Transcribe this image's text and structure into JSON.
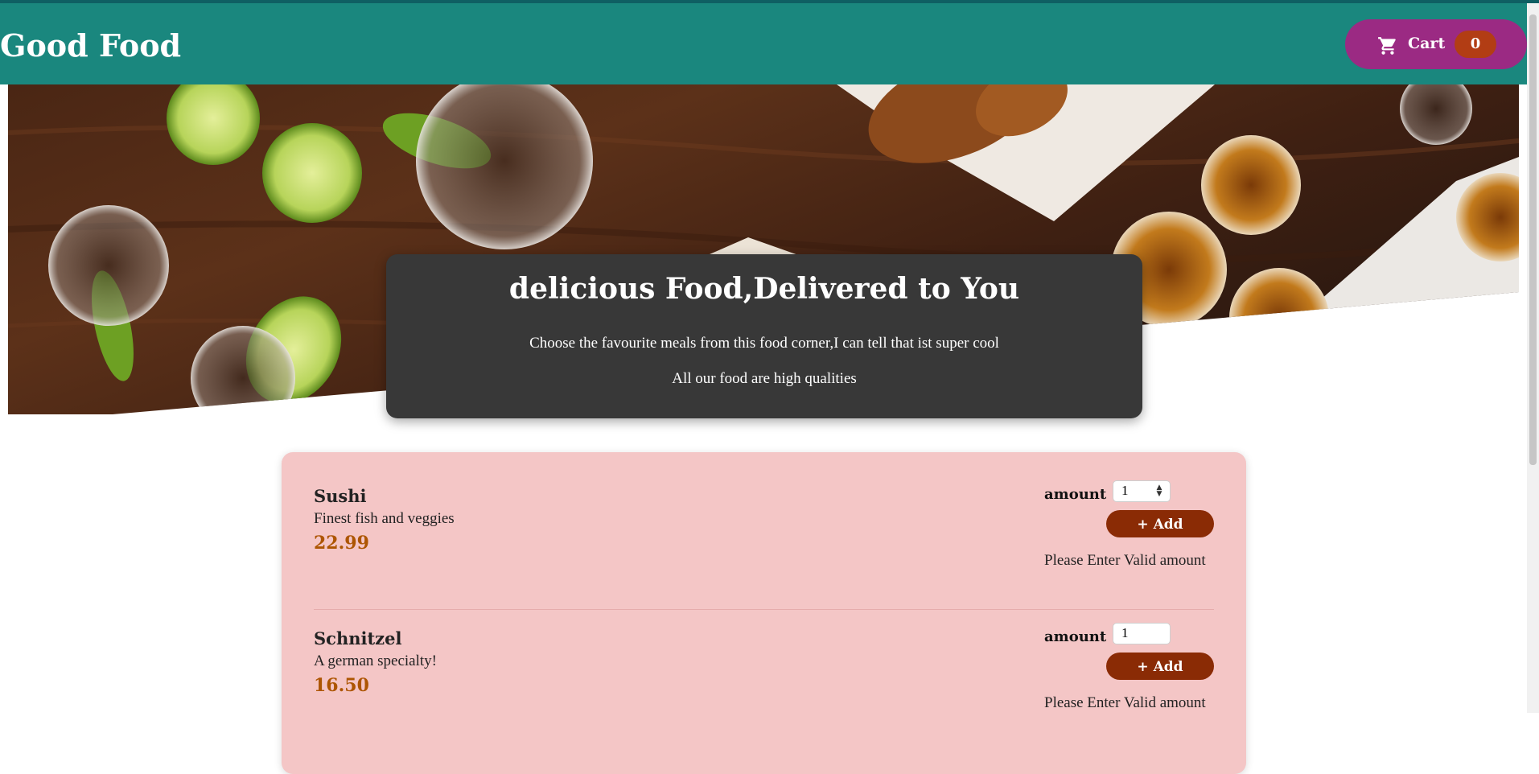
{
  "header": {
    "brand": "Good Food",
    "cart_label": "Cart",
    "cart_count": "0",
    "cart_icon": "shopping-cart-icon"
  },
  "hero": {
    "image": "food-table-photo",
    "title": "delicious Food,Delivered to You",
    "line1": "Choose the favourite meals from this food corner,I can tell that ist super cool",
    "line2": "All our food are high qualities"
  },
  "meals": [
    {
      "name": "Sushi",
      "description": "Finest fish and veggies",
      "price": "22.99",
      "amount_label": "amount",
      "amount_value": "1",
      "add_label": "+ Add",
      "error": "Please Enter Valid amount"
    },
    {
      "name": "Schnitzel",
      "description": "A german specialty!",
      "price": "16.50",
      "amount_label": "amount",
      "amount_value": "1",
      "add_label": "+ Add",
      "error": "Please Enter Valid amount"
    }
  ],
  "colors": {
    "header": "#1a877e",
    "cart_button": "#9b2a83",
    "cart_badge": "#b23d14",
    "add_button": "#8a2b05",
    "meal_panel": "#f4c6c6",
    "price": "#ad5502",
    "intro_card": "#383838"
  }
}
